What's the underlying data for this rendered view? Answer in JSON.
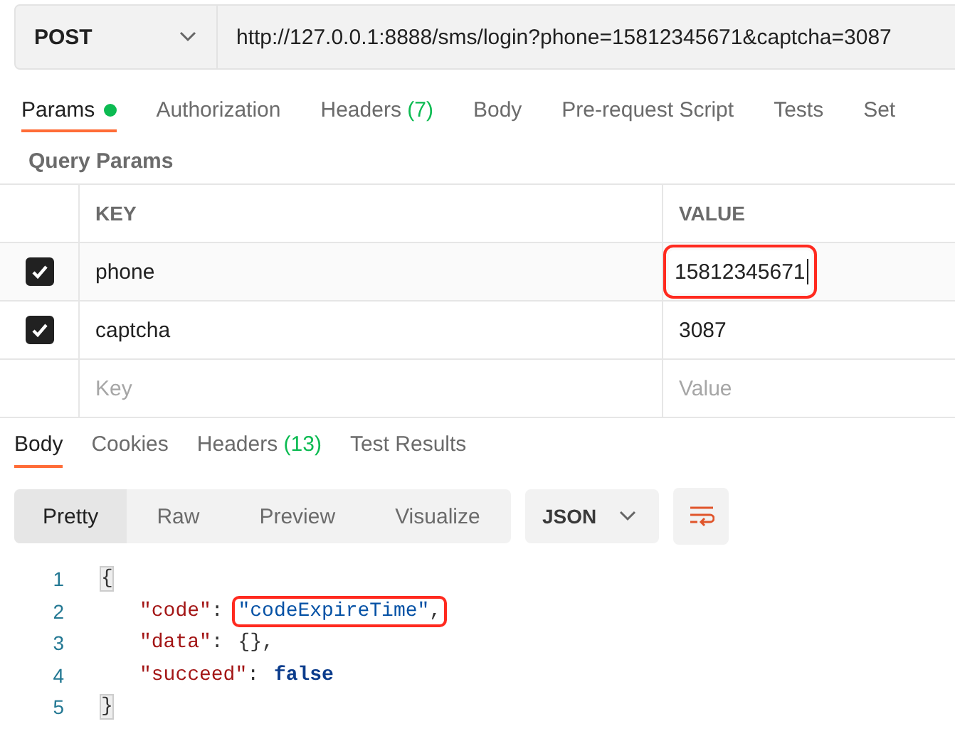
{
  "request": {
    "method": "POST",
    "url": "http://127.0.0.1:8888/sms/login?phone=15812345671&captcha=3087"
  },
  "request_tabs": [
    {
      "label": "Params",
      "dot": true,
      "selected": true
    },
    {
      "label": "Authorization",
      "dot": false,
      "selected": false
    },
    {
      "label": "Headers",
      "count": "(7)",
      "dot": false,
      "selected": false
    },
    {
      "label": "Body",
      "dot": false,
      "selected": false
    },
    {
      "label": "Pre-request Script",
      "dot": false,
      "selected": false
    },
    {
      "label": "Tests",
      "dot": false,
      "selected": false
    },
    {
      "label": "Set",
      "dot": false,
      "selected": false
    }
  ],
  "params": {
    "title": "Query Params",
    "columns": [
      "KEY",
      "VALUE"
    ],
    "rows": [
      {
        "checked": true,
        "key": "phone",
        "value": "15812345671",
        "editing": true,
        "annotated": true
      },
      {
        "checked": true,
        "key": "captcha",
        "value": "3087",
        "editing": false,
        "annotated": false
      }
    ],
    "new_row": {
      "key_placeholder": "Key",
      "value_placeholder": "Value"
    }
  },
  "response_tabs": [
    {
      "label": "Body",
      "selected": true
    },
    {
      "label": "Cookies",
      "selected": false
    },
    {
      "label": "Headers",
      "count": "(13)",
      "selected": false
    },
    {
      "label": "Test Results",
      "selected": false
    }
  ],
  "view_modes": [
    {
      "label": "Pretty",
      "selected": true
    },
    {
      "label": "Raw",
      "selected": false
    },
    {
      "label": "Preview",
      "selected": false
    },
    {
      "label": "Visualize",
      "selected": false
    }
  ],
  "format": "JSON",
  "code_lines": [
    {
      "number": "1",
      "kind": "brace",
      "text": "{"
    },
    {
      "number": "2",
      "kind": "pair",
      "key": "\"code\"",
      "sep": ":",
      "value": "\"codeExpireTime\"",
      "color": "#0451a5",
      "bold": false,
      "comma": ",",
      "annotated": true
    },
    {
      "number": "3",
      "kind": "pair",
      "key": "\"data\"",
      "sep": ":",
      "value": "{}",
      "color": "#333333",
      "bold": false,
      "comma": ",",
      "annotated": false
    },
    {
      "number": "4",
      "kind": "pair",
      "key": "\"succeed\"",
      "sep": ":",
      "value": "false",
      "color": "#0b3c8c",
      "bold": true,
      "annotated": false
    },
    {
      "number": "5",
      "kind": "brace",
      "text": "}"
    }
  ]
}
